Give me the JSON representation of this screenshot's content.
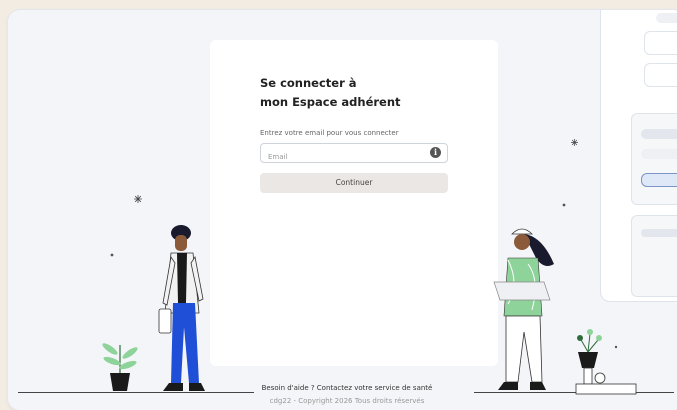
{
  "login": {
    "title_line1": "Se connecter à",
    "title_line2": "mon Espace adhérent",
    "email_label": "Entrez votre email pour vous connecter",
    "email_placeholder": "Email",
    "email_value": "",
    "continue_label": "Continuer"
  },
  "footer": {
    "help_text": "Besoin d'aide ? Contactez votre service de santé",
    "copyright_text": "cdg22 - Copyright 2026 Tous droits réservés"
  },
  "colors": {
    "page_bg": "#f3ece2",
    "window_bg": "#f4f5f8",
    "card_bg": "#ffffff",
    "accent_green": "#8ed39a",
    "accent_blue": "#1f4fd6"
  },
  "icons": {
    "info": "info-circle-icon"
  }
}
